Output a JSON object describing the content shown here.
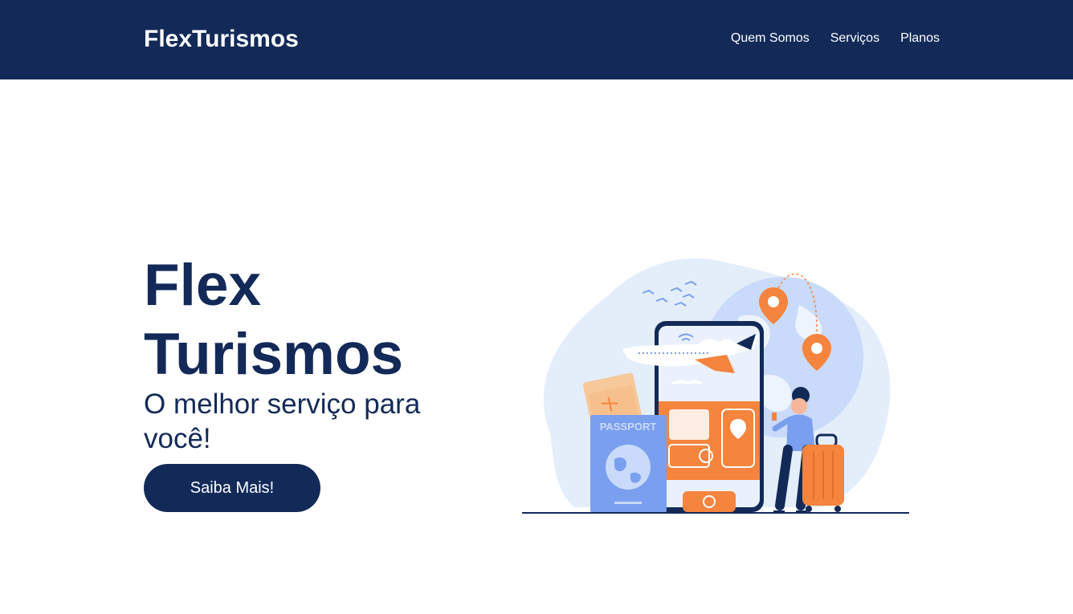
{
  "header": {
    "brand": "FlexTurismos",
    "nav": [
      {
        "label": "Quem Somos"
      },
      {
        "label": "Serviços"
      },
      {
        "label": "Planos"
      }
    ]
  },
  "hero": {
    "title_line1": "Flex",
    "title_line2": "Turismos",
    "subtitle": "O melhor serviço para você!",
    "cta_label": "Saiba Mais!"
  },
  "illustration": {
    "passport_label": "PASSPORT",
    "icon": "travel-illustration"
  },
  "colors": {
    "primary": "#132a58",
    "accent": "#f5843f",
    "light_blue": "#e4eefb",
    "mid_blue": "#7a9fef"
  }
}
